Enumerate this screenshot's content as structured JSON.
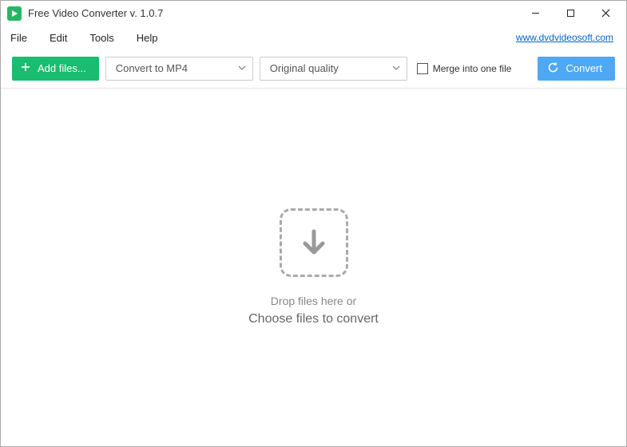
{
  "titlebar": {
    "title": "Free Video Converter v. 1.0.7"
  },
  "menubar": {
    "items": [
      "File",
      "Edit",
      "Tools",
      "Help"
    ],
    "link": "www.dvdvideosoft.com"
  },
  "toolbar": {
    "add_label": "Add files...",
    "format_dropdown": "Convert to MP4",
    "quality_dropdown": "Original quality",
    "merge_label": "Merge into one file",
    "convert_label": "Convert"
  },
  "dropzone": {
    "line1": "Drop files here or",
    "line2": "Choose files to convert"
  },
  "colors": {
    "accent_green": "#1abc70",
    "accent_blue": "#4ea8f4"
  }
}
